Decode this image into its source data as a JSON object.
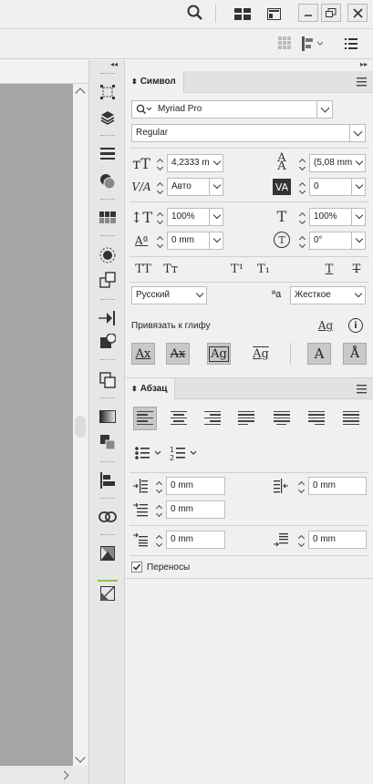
{
  "window": {
    "controls": [
      "search-icon",
      "workspace-icon",
      "panel-icon",
      "minimize",
      "restore",
      "close"
    ]
  },
  "panels": {
    "collapse_left": "◂◂",
    "collapse_right": "▸▸"
  },
  "character": {
    "tab_label": "Символ",
    "font_family": "Myriad Pro",
    "font_style": "Regular",
    "font_size": "4,2333 m",
    "leading": "(5,08 mm",
    "kerning": "Авто",
    "tracking": "0",
    "vertical_scale": "100%",
    "horizontal_scale": "100%",
    "baseline_shift": "0 mm",
    "skew": "0°",
    "caps_all": "TT",
    "caps_small": "Tт",
    "superscript": "T¹",
    "subscript": "T₁",
    "underline": "T",
    "strikethrough": "T",
    "language": "Русский",
    "hyphen_label": "ªa",
    "hyphen_value": "Жесткое",
    "snap_label": "Привязать к глифу"
  },
  "paragraph": {
    "tab_label": "Абзац",
    "left_indent": "0 mm",
    "right_indent": "0 mm",
    "first_line_indent": "0 mm",
    "space_before": "0 mm",
    "space_after": "0 mm",
    "hyphenation_label": "Переносы",
    "hyphenation_checked": true
  },
  "colors": {
    "panel_bg": "#f0f0f0",
    "pasteboard": "#a5a5a5",
    "selected_btn": "#c9c9c9",
    "accent_green": "#8bc34a"
  }
}
